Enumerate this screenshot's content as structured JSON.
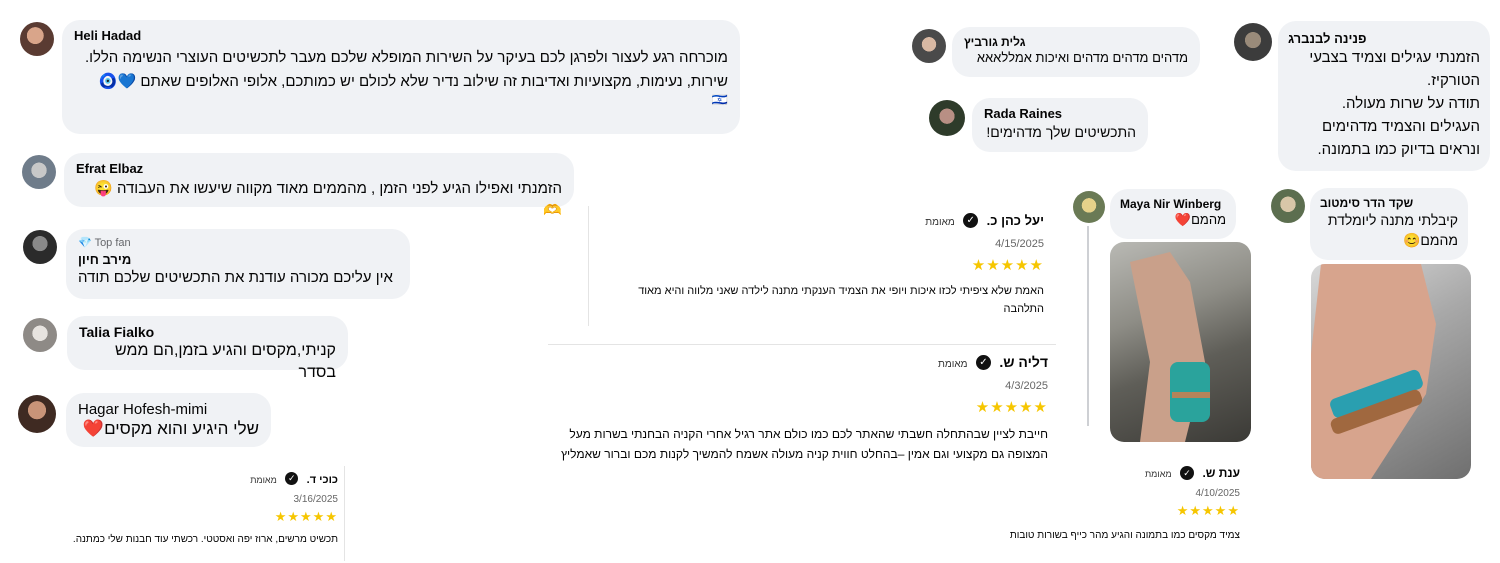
{
  "comments": {
    "heli": {
      "name": "Heli Hadad",
      "line1": "מוכרחה רגע לעצור ולפרגן לכם בעיקר על השירות המופלא שלכם מעבר לתכשיטים העוצרי הנשימה הללו.",
      "line2": "שירות, נעימות, מקצועיות ואדיבות זה שילוב נדיר שלא לכולם יש כמותכם, אלופי האלופים שאתם 💙🧿",
      "flag": "🇮🇱"
    },
    "efrat": {
      "name": "Efrat Elbaz",
      "text": "הזמנתי ואפילו הגיע לפני הזמן , מהממים מאוד מקווה שיעשו את העבודה 😜🫶"
    },
    "merav": {
      "badge": "Top fan",
      "name": "מירב חיון",
      "text": "אין עליכם מכורה עודנת את התכשיטים שלכם תודה"
    },
    "talia": {
      "name": "Talia Fialko",
      "text": "קניתי,מקסים והגיע בזמן,הם ממש בסדר"
    },
    "hagar": {
      "name": "Hagar Hofesh-mimi",
      "text": "שלי היגיע והוא מקסים❤️"
    },
    "galit": {
      "name": "גלית גורביץ",
      "text": "מדהים מדהים מדהים ואיכות אמללאאא"
    },
    "rada": {
      "name": "Rada Raines",
      "text": "התכשיטים שלך מדהימים!"
    },
    "penina": {
      "name": "פנינה לבנברג",
      "lines": [
        "הזמנתי עגילים וצמיד בצבעי",
        "הטורקיז.",
        "תודה על שרות מעולה.",
        "העגילים והצמיד מדהימים",
        "ונראים בדיוק כמו בתמונה."
      ]
    },
    "maya": {
      "name": "Maya Nir Winberg",
      "text": "מהמם❤️"
    },
    "shaked": {
      "name": "שקד הדר סימטוב",
      "line1": "קיבלתי מתנה ליומלדת",
      "line2": "מהמם😊"
    }
  },
  "reviews": {
    "verified_label": "מאומת",
    "yael": {
      "name": "יעל כהן כ.",
      "date": "4/15/2025",
      "stars": "★★★★★",
      "rating": 5,
      "body": "האמת שלא ציפיתי לכזו איכות ויופי את הצמיד הענקתי מתנה לילדה שאני מלווה והיא מאוד התלהבה"
    },
    "dalia": {
      "name": "דליה ש.",
      "date": "4/3/2025",
      "stars": "★★★★★",
      "rating": 5,
      "body": "חייבת לציין שבהתחלה חשבתי שהאתר לכם כמו כולם אתר רגיל אחרי הקניה הבחנתי בשרות מעל המצופה גם מקצועי וגם אמין –בהחלט חווית קניה מעולה אשמח להמשיך לקנות מכם וברור שאמליץ לחברות ❤️"
    },
    "kochi": {
      "name": "כוכי ד.",
      "date": "3/16/2025",
      "stars": "★★★★★",
      "rating": 5,
      "body": "תכשיט מרשים, ארוז יפה ואסטטי. רכשתי עוד חבנות שלי כמתנה."
    },
    "anat": {
      "name": "ענת ש.",
      "date": "4/10/2025",
      "stars": "★★★★★",
      "rating": 5,
      "body": "צמיד מקסים כמו בתמונה והגיע מהר כייף בשורות טובות"
    }
  },
  "colors": {
    "bubble": "#f0f2f5",
    "star": "#f6c600",
    "verified": "#111111"
  }
}
